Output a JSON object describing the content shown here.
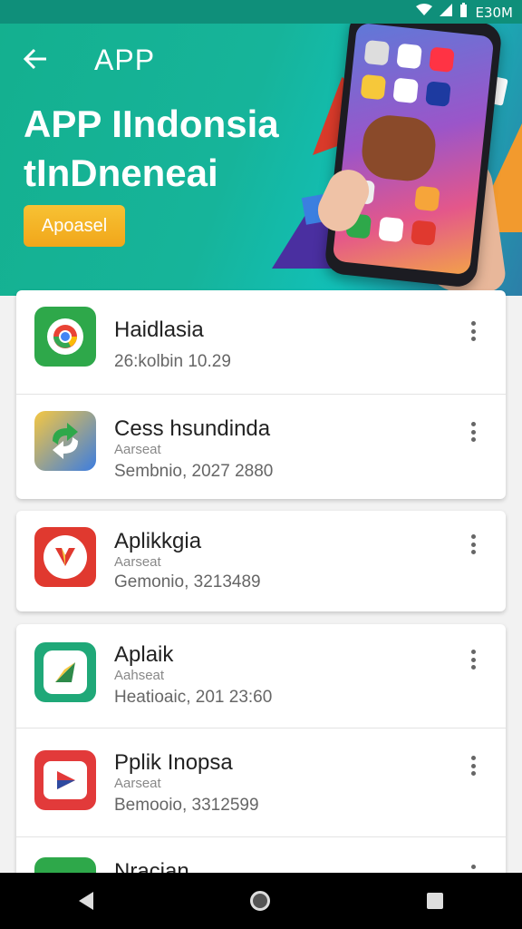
{
  "status_bar": {
    "time": "E30M"
  },
  "header": {
    "back_icon": "arrow-left-icon",
    "title": "APP",
    "headline_line1": "APP IIndonsia",
    "headline_line2": "tInDneneai",
    "cta_label": "Apoasel"
  },
  "apps": [
    {
      "name": "Haidlasia",
      "sub": "",
      "meta": "26:kolbin 10.29",
      "icon": "chrome-like-icon",
      "color": "#2ea84a"
    },
    {
      "name": "Cess hsundinda",
      "sub": "Aarseat",
      "meta": "Sembnio, 2027 2880",
      "icon": "sync-arrows-icon",
      "color": "#3c7de0"
    },
    {
      "name": "Aplikkgia",
      "sub": "Aarseat",
      "meta": "Gemonio, 3213489",
      "icon": "y-logo-icon",
      "color": "#e0392f"
    },
    {
      "name": "Aplaik",
      "sub": "Aahseat",
      "meta": "Heatioaic, 201 23:60",
      "icon": "play-arrow-icon",
      "color": "#1fa878"
    },
    {
      "name": "Pplik Inopsa",
      "sub": "Aarseat",
      "meta": "Bemooio, 3312599",
      "icon": "play-triangle-icon",
      "color": "#e23a3a"
    },
    {
      "name": "Nracian",
      "sub": "",
      "meta": "",
      "icon": "app-icon",
      "color": "#2ea84a"
    }
  ],
  "nav": {
    "back": "back-icon",
    "home": "home-icon",
    "recents": "recents-icon"
  }
}
